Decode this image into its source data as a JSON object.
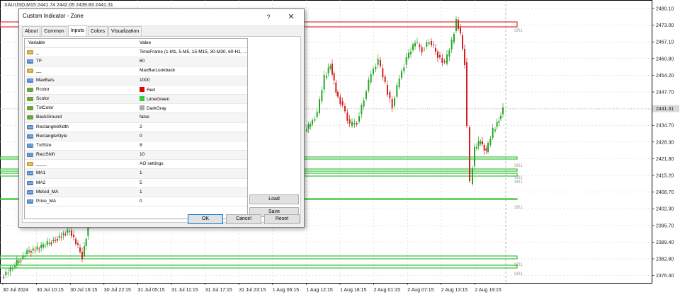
{
  "chart": {
    "header": "XAUUSD,M15  2441.74 2442.05 2439.83 2441.31",
    "price_labels": [
      "2480.10",
      "2473.00",
      "2467.10",
      "2460.80",
      "2454.20",
      "2447.70",
      "2441.31",
      "2434.70",
      "2428.30",
      "2421.80",
      "2415.20",
      "2408.70",
      "2402.30",
      "2395.70",
      "2389.40",
      "2382.80",
      "2376.40"
    ],
    "current_price": "2441.31",
    "time_labels": [
      "30 Jul 2024",
      "30 Jul 10:15",
      "30 Jul 16:15",
      "30 Jul 22:15",
      "31 Jul 05:15",
      "31 Jul 11:15",
      "31 Jul 17:15",
      "31 Jul 23:15",
      "1 Aug 06:15",
      "1 Aug 12:15",
      "1 Aug 18:15",
      "2 Aug 01:15",
      "2 Aug 07:15",
      "2 Aug 13:15",
      "2 Aug 19:15"
    ],
    "zone_labels": [
      "SR1",
      "SR1",
      "SR1",
      "SR1",
      "SR1",
      "SR1",
      "SR1"
    ],
    "colors": {
      "bull": "#26a626",
      "bear": "#d42020",
      "resistance": "#e03030",
      "support": "#33c233",
      "grid": "#c8c8c8",
      "current_price_bg": "#d9d9d9"
    }
  },
  "dialog": {
    "title": "Custom Indicator - Zone",
    "help": "?",
    "close": "✕",
    "tabs": [
      "About",
      "Common",
      "Inputs",
      "Colors",
      "Visualization"
    ],
    "columns": {
      "variable": "Variable",
      "value": "Value"
    },
    "rows": [
      {
        "type": "str",
        "name": "_",
        "value": "TimeFrame (1-M1, 5-M5, 15-M15, 30-M30, 60-H1, ..."
      },
      {
        "type": "int",
        "name": "TF",
        "value": "60"
      },
      {
        "type": "str",
        "name": "__",
        "value": "MaxBarLookback"
      },
      {
        "type": "int",
        "name": "MaxBars",
        "value": "1000"
      },
      {
        "type": "col",
        "name": "Rcolor",
        "value": "Red",
        "swatch": "#e00000"
      },
      {
        "type": "col",
        "name": "Scolor",
        "value": "LimeGreen",
        "swatch": "#32cd32"
      },
      {
        "type": "col",
        "name": "TxtColor",
        "value": "DarkGray",
        "swatch": "#a9a9a9"
      },
      {
        "type": "bool",
        "name": "BackGround",
        "value": "false"
      },
      {
        "type": "int",
        "name": "RectangleWidth",
        "value": "2"
      },
      {
        "type": "int",
        "name": "RectangleStyle",
        "value": "0"
      },
      {
        "type": "int",
        "name": "TxtSize",
        "value": "8"
      },
      {
        "type": "int",
        "name": "RectShift",
        "value": "10"
      },
      {
        "type": "str",
        "name": "____",
        "value": "AO settings"
      },
      {
        "type": "int",
        "name": "MA1",
        "value": "1"
      },
      {
        "type": "int",
        "name": "MA2",
        "value": "5"
      },
      {
        "type": "int",
        "name": "Metod_MA",
        "value": "1"
      },
      {
        "type": "int",
        "name": "Price_MA",
        "value": "0"
      }
    ],
    "buttons": {
      "load": "Load",
      "save": "Save",
      "ok": "OK",
      "cancel": "Cancel",
      "reset": "Reset"
    }
  }
}
